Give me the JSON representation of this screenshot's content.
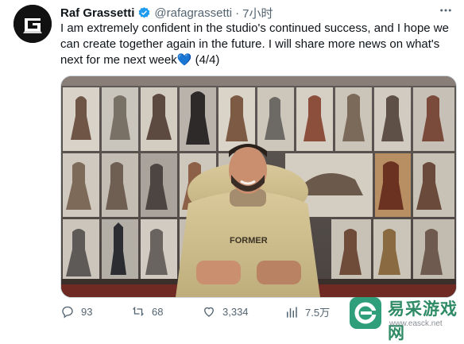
{
  "author": {
    "name": "Raf Grassetti",
    "handle": "@rafagrassetti",
    "separator": "·",
    "time": "7小时",
    "avatar_letter": "G",
    "verified_icon": "verified-badge-icon"
  },
  "tweet": {
    "text": "I am extremely confident in the studio's continued success, and I hope we can create together again in the future. I will share more news on what's next for me next week",
    "emoji": "💙",
    "suffix": " (4/4)"
  },
  "more_icon": "more-options-icon",
  "media": {
    "shirt_text": "FORMER"
  },
  "actions": {
    "replies": "93",
    "retweets": "68",
    "likes": "3,334",
    "views": "7.5万"
  },
  "watermark": {
    "title": "易采游戏网",
    "url": "www.easck.net"
  },
  "colors": {
    "text": "#0f1419",
    "secondary": "#536471",
    "verified": "#1d9bf0",
    "watermark": "#2f9e7a"
  }
}
